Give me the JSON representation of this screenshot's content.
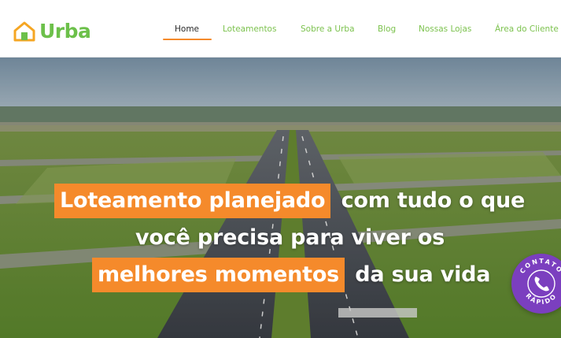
{
  "brand": {
    "name": "Urba",
    "primary_color": "#6cc04a",
    "accent_color": "#f58a2b",
    "badge_color": "#7b3fbf"
  },
  "nav": {
    "items": [
      {
        "label": "Home",
        "active": true
      },
      {
        "label": "Loteamentos",
        "active": false
      },
      {
        "label": "Sobre a Urba",
        "active": false
      },
      {
        "label": "Blog",
        "active": false
      },
      {
        "label": "Nossas Lojas",
        "active": false
      },
      {
        "label": "Área do Cliente",
        "active": false
      }
    ]
  },
  "hero": {
    "line1_highlight": "Loteamento planejado",
    "line1_rest": "com tudo o que",
    "line2": "você precisa para viver os",
    "line3_highlight": "melhores momentos",
    "line3_rest": "da sua vida"
  },
  "contact_badge": {
    "top_text": "CONTATO",
    "bottom_text": "RÁPIDO",
    "icon": "phone-icon"
  }
}
